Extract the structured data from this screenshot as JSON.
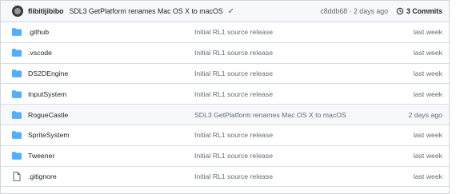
{
  "commit": {
    "author": "flibitijibibo",
    "message": "SDL3 GetPlatform renames Mac OS X to macOS",
    "hash_age": "c8ddb68 · 2 days ago",
    "commits_label": "3 Commits"
  },
  "files": [
    {
      "name": ".github",
      "type": "folder",
      "message": "Initial RL1 source release",
      "age": "last week"
    },
    {
      "name": ".vscode",
      "type": "folder",
      "message": "Initial RL1 source release",
      "age": "last week"
    },
    {
      "name": "DS2DEngine",
      "type": "folder",
      "message": "Initial RL1 source release",
      "age": "last week"
    },
    {
      "name": "InputSystem",
      "type": "folder",
      "message": "Initial RL1 source release",
      "age": "last week"
    },
    {
      "name": "RogueCastle",
      "type": "folder",
      "message": "SDL3 GetPlatform renames Mac OS X to macOS",
      "age": "2 days ago"
    },
    {
      "name": "SpriteSystem",
      "type": "folder",
      "message": "Initial RL1 source release",
      "age": "last week"
    },
    {
      "name": "Tweener",
      "type": "folder",
      "message": "Initial RL1 source release",
      "age": "last week"
    },
    {
      "name": ".gitignore",
      "type": "file",
      "message": "Initial RL1 source release",
      "age": "last week"
    }
  ],
  "colors": {
    "folder": "#54aeff",
    "file": "#636c76",
    "check": "#1a7f37"
  }
}
